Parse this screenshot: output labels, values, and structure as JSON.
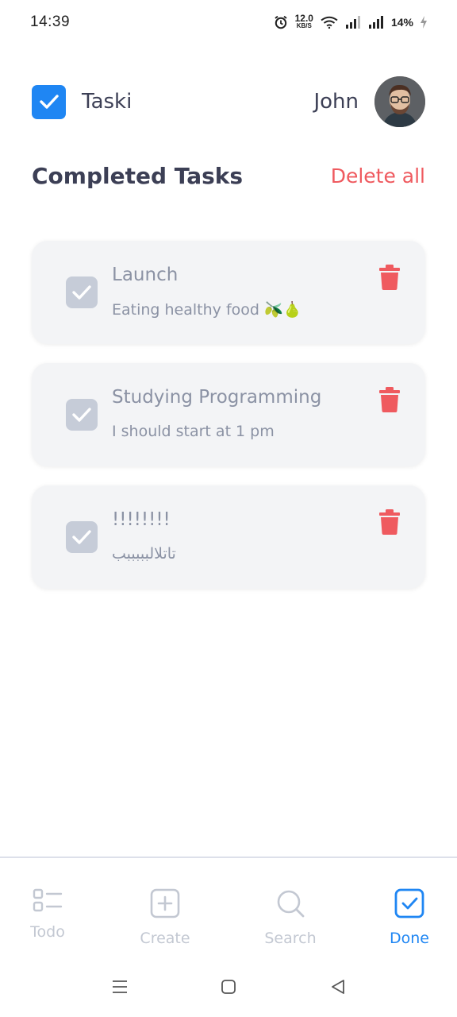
{
  "status_bar": {
    "time": "14:39",
    "net_speed_value": "12.0",
    "net_speed_unit": "KB/S",
    "battery": "14%"
  },
  "header": {
    "app_name": "Taski",
    "user_name": "John"
  },
  "section": {
    "title": "Completed Tasks",
    "delete_all_label": "Delete all"
  },
  "tasks": [
    {
      "title": "Launch",
      "description": "Eating healthy food 🫒🍐",
      "completed": true
    },
    {
      "title": "Studying Programming",
      "description": "I should start at 1 pm",
      "completed": true
    },
    {
      "title": "!!!!!!!!",
      "description": "تاتلالبببببب",
      "completed": true
    }
  ],
  "bottom_nav": {
    "items": [
      {
        "label": "Todo",
        "icon": "list-icon",
        "active": false
      },
      {
        "label": "Create",
        "icon": "plus-square-icon",
        "active": false
      },
      {
        "label": "Search",
        "icon": "search-icon",
        "active": false
      },
      {
        "label": "Done",
        "icon": "check-square-icon",
        "active": true
      }
    ]
  },
  "colors": {
    "accent": "#1f86f3",
    "danger": "#ef5a5f",
    "muted": "#8b92a4",
    "card": "#f3f4f6"
  }
}
